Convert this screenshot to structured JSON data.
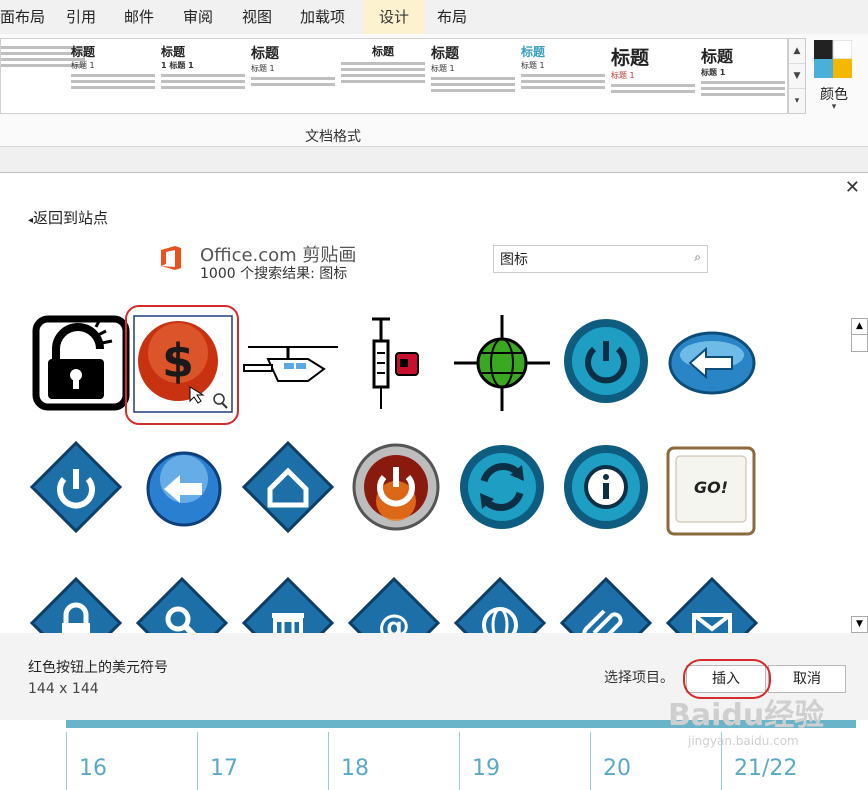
{
  "ribbon": {
    "tabs": [
      "面布局",
      "引用",
      "邮件",
      "审阅",
      "视图",
      "加载项",
      "设计",
      "布局"
    ],
    "active_tab": "设计",
    "styles": [
      {
        "heading": "",
        "sub": ""
      },
      {
        "heading": "标题",
        "sub": "标题 1"
      },
      {
        "heading": "标题",
        "sub": "1 标题 1"
      },
      {
        "heading": "标题",
        "sub": "标题 1"
      },
      {
        "heading": "标题",
        "sub": ""
      },
      {
        "heading": "标题",
        "sub": "标题 1"
      },
      {
        "heading": "标题",
        "sub": "标题 1"
      },
      {
        "heading": "标题",
        "sub": "标题 1"
      },
      {
        "heading": "标题",
        "sub": "标题 1"
      }
    ],
    "group_label": "文档格式",
    "colors_label": "颜色"
  },
  "dialog": {
    "back_label": "返回到站点",
    "brand": "Office.com 剪贴画",
    "result_count": "1000 个搜索结果: 图标",
    "search_value": "图标",
    "selected_description": "红色按钮上的美元符号",
    "selected_dims": "144 x 144",
    "status_text": "选择项目。",
    "insert_label": "插入",
    "cancel_label": "取消",
    "go_text": "GO!"
  },
  "document": {
    "dates": [
      "16",
      "17",
      "18",
      "19",
      "20",
      "21/22"
    ]
  },
  "watermark": {
    "brand": "Baidu经验",
    "url": "jingyan.baidu.com"
  },
  "colors": {
    "accent": "#2b6e99",
    "selection_ring": "#d62b2b",
    "ribbon_active": "#fdf2d0"
  }
}
